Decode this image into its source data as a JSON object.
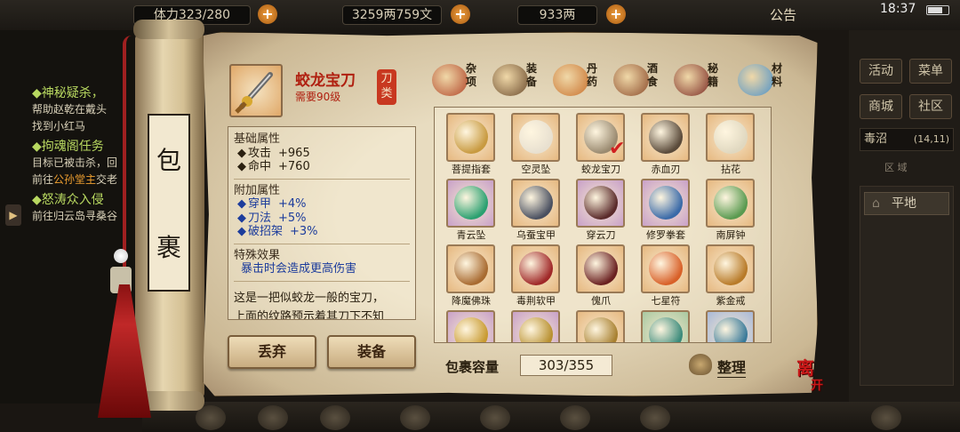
{
  "topbar": {
    "stamina": "体力323/280",
    "money": "3259两759文",
    "gold": "933两",
    "announce": "公告",
    "clock": "18:37"
  },
  "quests": [
    {
      "title": "◆神秘疑杀，",
      "lines": [
        {
          "pre": "帮助赵乾在戴头",
          "hl": "",
          "post": ""
        },
        {
          "pre": "找到小红马",
          "hl": "",
          "post": ""
        }
      ]
    },
    {
      "title": "◆拘魂阁任务",
      "lines": [
        {
          "pre": "目标已被击杀，回",
          "hl": "",
          "post": ""
        },
        {
          "pre": "前往",
          "hl": "公孙堂主",
          "post": "交老"
        }
      ]
    },
    {
      "title": "◆怒涛众入侵",
      "lines": [
        {
          "pre": "前往归云岛寻桑谷",
          "hl": "",
          "post": ""
        }
      ]
    }
  ],
  "right_panel": {
    "buttons": [
      "活动",
      "菜单",
      "商城",
      "社区"
    ],
    "map_name": "毒沼",
    "map_coord": "(14,11)",
    "tab_label": "区 域",
    "terrain": "平地"
  },
  "scroll": {
    "char1": "包",
    "char2": "裹"
  },
  "selected": {
    "name": "蛟龙宝刀",
    "level": "需要90级",
    "type": "刀类",
    "base_title": "基础属性",
    "base": [
      {
        "name": "攻击",
        "value": "+965"
      },
      {
        "name": "命中",
        "value": "+760"
      }
    ],
    "extra_title": "附加属性",
    "extra": [
      {
        "name": "穿甲",
        "value": "+4%"
      },
      {
        "name": "刀法",
        "value": "+5%"
      },
      {
        "name": "破招架",
        "value": "+3%"
      }
    ],
    "special_title": "特殊效果",
    "special": "暴击时会造成更高伤害",
    "desc1": "这是一把似蛟龙一般的宝刀，",
    "desc2": "上面的纹路预示着其刀下不知"
  },
  "actions": {
    "discard": "丢弃",
    "equip": "装备"
  },
  "categories": [
    {
      "label": "杂项",
      "icon": "jar-icon",
      "color": "#b04428"
    },
    {
      "label": "装备",
      "icon": "armor-bundle-icon",
      "color": "#6a4a2c"
    },
    {
      "label": "丹药",
      "icon": "pill-tray-icon",
      "color": "#c8702c"
    },
    {
      "label": "酒食",
      "icon": "wine-food-icon",
      "color": "#8a4a2a"
    },
    {
      "label": "秘籍",
      "icon": "books-icon",
      "color": "#7a2a24"
    },
    {
      "label": "材料",
      "icon": "crystal-icon",
      "color": "#4a90c8"
    }
  ],
  "items": [
    {
      "name": "菩提指套",
      "icon": "finger-guard-icon",
      "frame": "",
      "color": "#c89a40"
    },
    {
      "name": "空灵坠",
      "icon": "pendant-icon",
      "frame": "",
      "color": "#e8e0d0"
    },
    {
      "name": "蛟龙宝刀",
      "icon": "saber-icon",
      "frame": "",
      "color": "#9a8a70",
      "equipped": true
    },
    {
      "name": "赤血刃",
      "icon": "blade-icon",
      "frame": "",
      "color": "#5a4a3a"
    },
    {
      "name": "拈花",
      "icon": "flower-icon",
      "frame": "",
      "color": "#e0d8c0"
    },
    {
      "name": "青云坠",
      "icon": "jade-pendant-icon",
      "frame": "purple",
      "color": "#2aa070"
    },
    {
      "name": "乌蚕宝甲",
      "icon": "armor-icon",
      "frame": "",
      "color": "#4a5060"
    },
    {
      "name": "穿云刀",
      "icon": "dagger-icon",
      "frame": "purple",
      "color": "#5a2a2a"
    },
    {
      "name": "修罗拳套",
      "icon": "gauntlet-icon",
      "frame": "purple",
      "color": "#3a6aa8"
    },
    {
      "name": "南屏钟",
      "icon": "bell-icon",
      "frame": "",
      "color": "#5a9a50"
    },
    {
      "name": "降魔佛珠",
      "icon": "prayer-beads-icon",
      "frame": "",
      "color": "#a86a30"
    },
    {
      "name": "毒荆软甲",
      "icon": "red-armor-icon",
      "frame": "",
      "color": "#a02828"
    },
    {
      "name": "傀爪",
      "icon": "claw-icon",
      "frame": "",
      "color": "#6a2020"
    },
    {
      "name": "七星符",
      "icon": "talisman-icon",
      "frame": "",
      "color": "#d86028"
    },
    {
      "name": "紫金戒",
      "icon": "ring-icon",
      "frame": "",
      "color": "#b87a28"
    },
    {
      "name": "",
      "icon": "ring-icon",
      "frame": "purple",
      "color": "#c89a30"
    },
    {
      "name": "",
      "icon": "bracer-icon",
      "frame": "purple",
      "color": "#b89030"
    },
    {
      "name": "",
      "icon": "bracer-icon",
      "frame": "",
      "color": "#a88030"
    },
    {
      "name": "",
      "icon": "helmet-icon",
      "frame": "green",
      "color": "#3a8a7a"
    },
    {
      "name": "",
      "icon": "helmet-icon",
      "frame": "blue",
      "color": "#3a7a9a"
    }
  ],
  "capacity": {
    "label": "包裹容量",
    "value": "303/355"
  },
  "sort_label": "整理",
  "leave_label": "离开"
}
